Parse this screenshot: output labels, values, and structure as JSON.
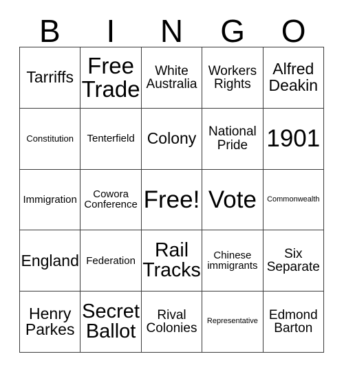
{
  "card": {
    "type": "bingo-card",
    "topic": "Australian Federation",
    "background_color": "#ffffff",
    "text_color": "#000000",
    "border_color": "#3a3a3a",
    "columns": 5,
    "rows": 5,
    "header": {
      "letters": [
        "B",
        "I",
        "N",
        "G",
        "O"
      ]
    },
    "cells": [
      [
        {
          "text": "Tarriffs",
          "size": "l",
          "free": false
        },
        {
          "text": "Free\nTrade",
          "size": "xxl",
          "free": false
        },
        {
          "text": "White\nAustralia",
          "size": "m",
          "free": false
        },
        {
          "text": "Workers\nRights",
          "size": "m",
          "free": false
        },
        {
          "text": "Alfred\nDeakin",
          "size": "l",
          "free": false
        }
      ],
      [
        {
          "text": "Constitution",
          "size": "xs",
          "free": false
        },
        {
          "text": "Tenterfield",
          "size": "s",
          "free": false
        },
        {
          "text": "Colony",
          "size": "l",
          "free": false
        },
        {
          "text": "National\nPride",
          "size": "m",
          "free": false
        },
        {
          "text": "1901",
          "size": "xxl",
          "free": false
        }
      ],
      [
        {
          "text": "Immigration",
          "size": "s",
          "free": false
        },
        {
          "text": "Cowora\nConference",
          "size": "s",
          "free": false
        },
        {
          "text": "Free!",
          "size": "xxl",
          "free": true
        },
        {
          "text": "Vote",
          "size": "xxl",
          "free": false
        },
        {
          "text": "Commonwealth",
          "size": "xxs",
          "free": false
        }
      ],
      [
        {
          "text": "England",
          "size": "l",
          "free": false
        },
        {
          "text": "Federation",
          "size": "s",
          "free": false
        },
        {
          "text": "Rail\nTracks",
          "size": "xl",
          "free": false
        },
        {
          "text": "Chinese\nimmigrants",
          "size": "s",
          "free": false
        },
        {
          "text": "Six\nSeparate",
          "size": "m",
          "free": false
        }
      ],
      [
        {
          "text": "Henry\nParkes",
          "size": "l",
          "free": false
        },
        {
          "text": "Secret\nBallot",
          "size": "xl",
          "free": false
        },
        {
          "text": "Rival\nColonies",
          "size": "m",
          "free": false
        },
        {
          "text": "Representative",
          "size": "xxs",
          "free": false
        },
        {
          "text": "Edmond\nBarton",
          "size": "m",
          "free": false
        }
      ]
    ]
  }
}
